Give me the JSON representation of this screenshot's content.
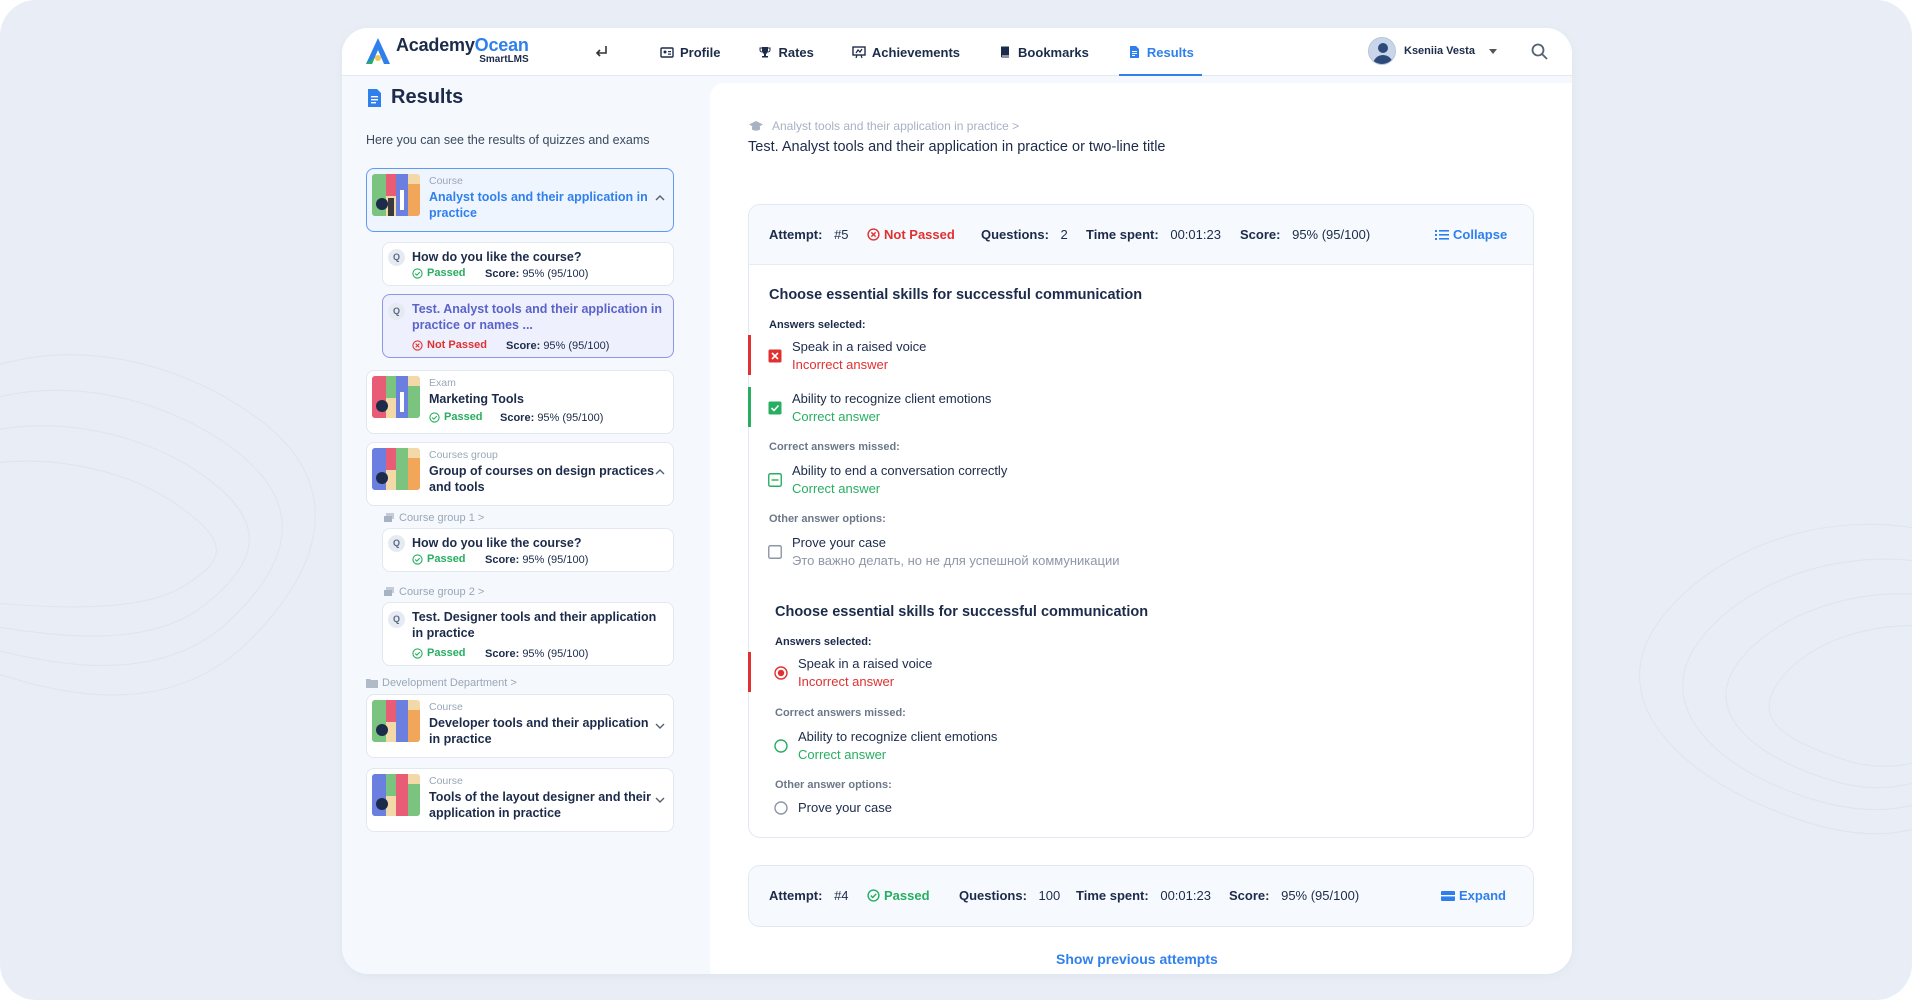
{
  "app": {
    "logo_academy": "Academy",
    "logo_ocean": "Ocean",
    "logo_smart": "Smart",
    "logo_lms": "LMS"
  },
  "nav": {
    "items": [
      {
        "label": "Profile"
      },
      {
        "label": "Rates"
      },
      {
        "label": "Achievements"
      },
      {
        "label": "Bookmarks"
      },
      {
        "label": "Results"
      }
    ]
  },
  "user": {
    "name": "Kseniia Vesta"
  },
  "colors": {
    "accent": "#2f80ed",
    "pass": "#27ae60",
    "fail": "#e03131"
  },
  "left": {
    "title": "Results",
    "subtitle": "Here you can see the results of quizzes and exams",
    "cards": [
      {
        "category": "Course",
        "title_line1": "Analyst tools and their application in",
        "title_line2": "practice"
      },
      {
        "category": "Exam",
        "title": "Marketing Tools",
        "status": "Passed",
        "score_label": "Score:",
        "score": "95% (95/100)"
      },
      {
        "category": "Courses group",
        "title_line1": "Group of courses on design practices",
        "title_line2": "and tools"
      },
      {
        "category": "Course",
        "title_line1": "Developer tools and their application",
        "title_line2": "in practice"
      },
      {
        "category": "Course",
        "title_line1": "Tools of the layout designer and their",
        "title_line2": "application in practice"
      }
    ],
    "quizzes": [
      {
        "badge": "Q",
        "title": "How do you like the course?",
        "status": "Passed",
        "score_label": "Score:",
        "score": "95% (95/100)"
      },
      {
        "badge": "Q",
        "title_line1": "Test. Analyst tools and their application in",
        "title_line2": "practice or names ...",
        "status": "Not Passed",
        "score_label": "Score:",
        "score": "95% (95/100)"
      },
      {
        "badge": "Q",
        "title": "How do you like the course?",
        "status": "Passed",
        "score_label": "Score:",
        "score": "95% (95/100)"
      },
      {
        "badge": "Q",
        "title_line1": "Test. Designer tools and their application",
        "title_line2": "in practice",
        "status": "Passed",
        "score_label": "Score:",
        "score": "95% (95/100)"
      }
    ],
    "crumbs": {
      "group1": "Course group 1 >",
      "group2": "Course group 2 >",
      "department": "Development Department >"
    }
  },
  "main": {
    "breadcrumb": "Analyst tools and their application in practice >",
    "title": "Test. Analyst tools and their application in practice or two-line title",
    "attempt1": {
      "attempt_label": "Attempt:",
      "attempt": "#5",
      "status": "Not Passed",
      "questions_label": "Questions:",
      "questions": "2",
      "time_label": "Time spent:",
      "time": "00:01:23",
      "score_label": "Score:",
      "score": "95% (95/100)",
      "toggle": "Collapse"
    },
    "q1": {
      "title": "Choose essential skills for successful communication",
      "selected_label": "Answers selected:",
      "a1": "Speak in a raised voice",
      "a1_note": "Incorrect answer",
      "a2": "Ability to recognize client emotions",
      "a2_note": "Correct answer",
      "missed_label": "Correct answers missed:",
      "a3": "Ability to end a conversation correctly",
      "a3_note": "Correct answer",
      "other_label": "Other answer options:",
      "a4": "Prove your case",
      "a4_note": "Это важно делать, но не для успешной коммуникации"
    },
    "q2": {
      "title": "Choose essential skills for successful communication",
      "selected_label": "Answers selected:",
      "a1": "Speak in a raised voice",
      "a1_note": "Incorrect answer",
      "missed_label": "Correct answers missed:",
      "a2": "Ability to recognize client emotions",
      "a2_note": "Correct answer",
      "other_label": "Other answer options:",
      "a3": "Prove your case"
    },
    "attempt2": {
      "attempt_label": "Attempt:",
      "attempt": "#4",
      "status": "Passed",
      "questions_label": "Questions:",
      "questions": "100",
      "time_label": "Time spent:",
      "time": "00:01:23",
      "score_label": "Score:",
      "score": "95% (95/100)",
      "toggle": "Expand"
    },
    "show_previous": "Show previous attempts"
  }
}
